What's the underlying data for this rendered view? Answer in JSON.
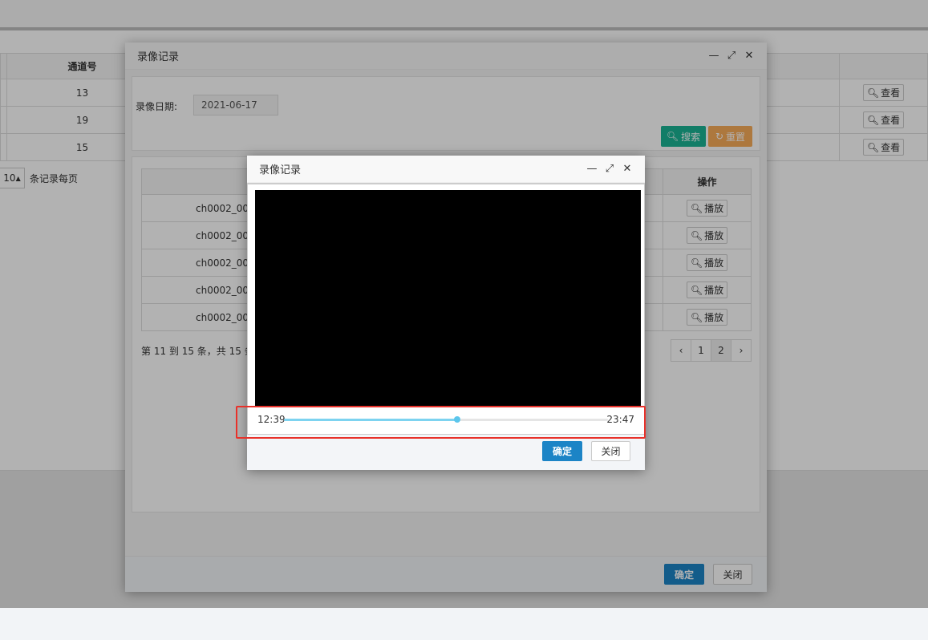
{
  "background": {
    "table": {
      "header": {
        "col2": "通道号"
      },
      "rows": [
        {
          "channel": "13",
          "action": "查看"
        },
        {
          "channel": "19",
          "action": "查看"
        },
        {
          "channel": "15",
          "action": "查看"
        }
      ]
    },
    "pager": {
      "page_size": "10",
      "suffix": "条记录每页"
    }
  },
  "outer_dialog": {
    "title": "录像记录",
    "search": {
      "date_label": "录像日期:",
      "date_value": "2021-06-17",
      "search_label": "搜索",
      "reset_label": "重置"
    },
    "table": {
      "ops_header": "操作",
      "rows": [
        {
          "file": "ch0002_000",
          "action": "播放"
        },
        {
          "file": "ch0002_000",
          "action": "播放"
        },
        {
          "file": "ch0002_000",
          "action": "播放"
        },
        {
          "file": "ch0002_000",
          "action": "播放"
        },
        {
          "file": "ch0002_000",
          "action": "播放"
        }
      ]
    },
    "summary": "第 11 到 15 条，共 15 条",
    "pages": [
      "1",
      "2"
    ],
    "ok_label": "确定",
    "close_label": "关闭"
  },
  "inner_dialog": {
    "title": "录像记录",
    "player": {
      "start_time": "12:39",
      "end_time": "23:47",
      "progress": 0.535
    },
    "ok_label": "确定",
    "close_label": "关闭"
  },
  "colors": {
    "highlight": "#e8312a",
    "primary": "#1c84c6",
    "search": "#1ab394",
    "reset": "#f8ac59",
    "progress": "#7dd3f0"
  }
}
